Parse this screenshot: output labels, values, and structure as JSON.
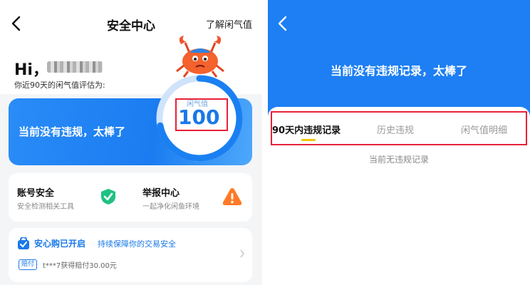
{
  "left": {
    "header": {
      "title": "安全中心",
      "right_link": "了解闲气值"
    },
    "greeting": "Hi，",
    "subtitle": "你近90天的闲气值评估为:",
    "status_card": {
      "message": "当前没有违规，太棒了",
      "gauge_label": "闲气值",
      "score": "100",
      "score_value": 100,
      "score_max": 100
    },
    "services": [
      {
        "title": "账号安全",
        "subtitle": "安全检测相关工具",
        "icon": "shield-check-icon",
        "icon_color": "#1fc183"
      },
      {
        "title": "举报中心",
        "subtitle": "一起净化闲鱼环境",
        "icon": "warning-icon",
        "icon_color": "#ff7a26"
      }
    ],
    "safe_buy": {
      "title": "安心购已开启",
      "description": "持续保障你的交易安全",
      "badge": "赔付",
      "claim_text": "t***7获得赔付30.00元"
    }
  },
  "right": {
    "headline": "当前没有违规记录，太棒了",
    "tabs": [
      "90天内违规记录",
      "历史违规",
      "闲气值明细"
    ],
    "active_tab": 0,
    "empty_text": "当前无违规记录"
  },
  "colors": {
    "brand_blue": "#1d7ff3",
    "highlight_red": "#e8203a",
    "tab_underline": "#f5c400"
  }
}
